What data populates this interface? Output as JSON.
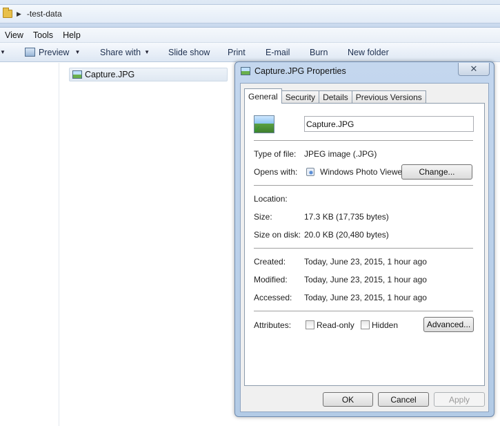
{
  "explorer": {
    "breadcrumb": "-test-data",
    "menu": [
      "View",
      "Tools",
      "Help"
    ],
    "toolbar": {
      "preview": "Preview",
      "share_with": "Share with",
      "slide_show": "Slide show",
      "print": "Print",
      "email": "E-mail",
      "burn": "Burn",
      "new_folder": "New folder"
    },
    "file_name": "Capture.JPG"
  },
  "dialog": {
    "title": "Capture.JPG Properties",
    "close_glyph": "✕",
    "tabs": [
      "General",
      "Security",
      "Details",
      "Previous Versions"
    ],
    "active_tab": "General",
    "file_name_value": "Capture.JPG",
    "type_label": "Type of file:",
    "type_value": "JPEG image (.JPG)",
    "opens_label": "Opens with:",
    "opens_value": "Windows Photo Viewer",
    "change_button": "Change...",
    "location_label": "Location:",
    "location_value": "",
    "size_label": "Size:",
    "size_value": "17.3 KB (17,735 bytes)",
    "size_disk_label": "Size on disk:",
    "size_disk_value": "20.0 KB (20,480 bytes)",
    "created_label": "Created:",
    "created_value": "Today, June 23, 2015, 1 hour ago",
    "modified_label": "Modified:",
    "modified_value": "Today, June 23, 2015, 1 hour ago",
    "accessed_label": "Accessed:",
    "accessed_value": "Today, June 23, 2015, 1 hour ago",
    "attributes_label": "Attributes:",
    "readonly_label": "Read-only",
    "hidden_label": "Hidden",
    "advanced_button": "Advanced...",
    "ok_button": "OK",
    "cancel_button": "Cancel",
    "apply_button": "Apply"
  }
}
